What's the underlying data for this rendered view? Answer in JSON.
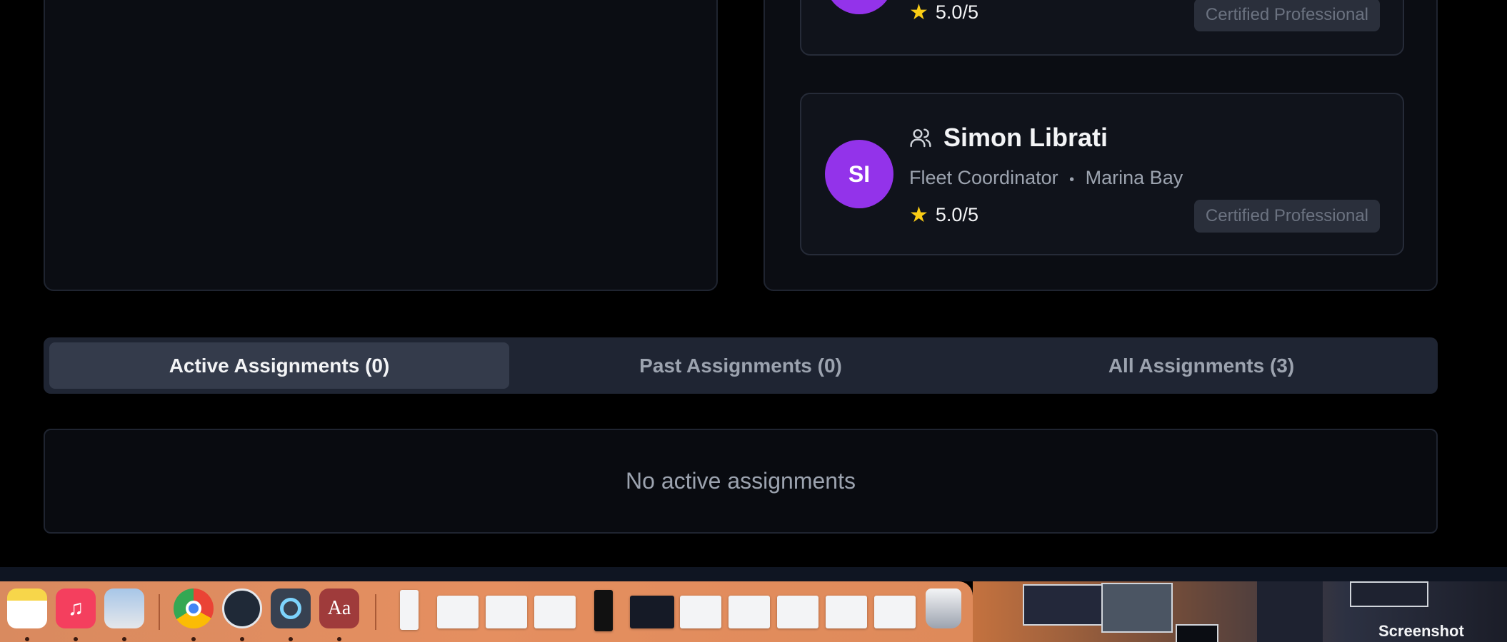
{
  "members": [
    {
      "initials": "",
      "rating": "5.0/5",
      "badge": "Certified Professional"
    },
    {
      "initials": "SI",
      "name": "Simon Librati",
      "role": "Fleet Coordinator",
      "separator": "•",
      "location": "Marina Bay",
      "rating": "5.0/5",
      "badge": "Certified Professional"
    }
  ],
  "tabs": [
    {
      "label": "Active Assignments (0)",
      "active": true
    },
    {
      "label": "Past Assignments (0)",
      "active": false
    },
    {
      "label": "All Assignments (3)",
      "active": false
    }
  ],
  "empty_state": "No active assignments",
  "dock": {
    "icons": [
      "notes-icon",
      "music-icon",
      "preview-icon",
      "chrome-icon",
      "universal-audio-icon",
      "quicktime-icon",
      "dictionary-icon",
      "trash-icon"
    ],
    "dictionary_glyph": "Aa",
    "screenshot_label": "Screenshot"
  },
  "colors": {
    "accent_avatar": "#9333ea",
    "star": "#facc15",
    "background": "#000000"
  }
}
